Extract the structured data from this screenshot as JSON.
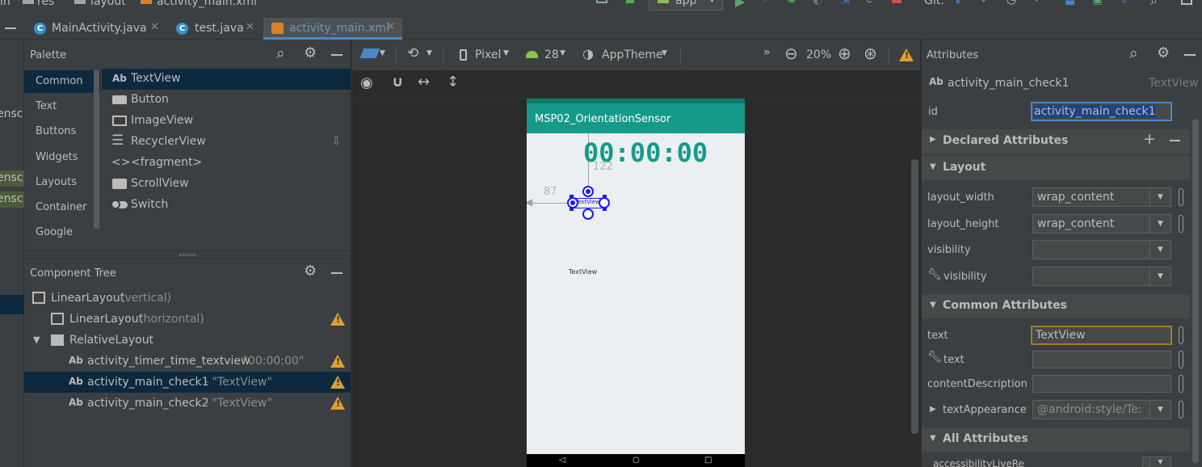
{
  "breadcrumb": {
    "seg1": "in",
    "seg2": "res",
    "seg3": "layout",
    "seg4": "activity_main.xml"
  },
  "toolbar": {
    "run_config": "app",
    "git_label": "Git:"
  },
  "tabs": [
    {
      "label": "MainActivity.java",
      "icon": "class-icon"
    },
    {
      "label": "test.java",
      "icon": "class-icon"
    },
    {
      "label": "activity_main.xml",
      "icon": "layout-xml-icon"
    }
  ],
  "left_edge_fragments": [
    "ensc",
    "ensc",
    "ensc"
  ],
  "palette": {
    "title": "Palette",
    "categories": [
      "Common",
      "Text",
      "Buttons",
      "Widgets",
      "Layouts",
      "Container",
      "Google"
    ],
    "items": [
      {
        "prefix": "Ab",
        "label": "TextView"
      },
      {
        "prefix": "",
        "label": "Button"
      },
      {
        "prefix": "",
        "label": "ImageView"
      },
      {
        "prefix": "",
        "label": "RecyclerView"
      },
      {
        "prefix": "<>",
        "label": "<fragment>"
      },
      {
        "prefix": "",
        "label": "ScrollView"
      },
      {
        "prefix": "",
        "label": "Switch"
      }
    ]
  },
  "component_tree": {
    "title": "Component Tree",
    "rows": [
      {
        "name": "LinearLayout",
        "suffix": "(vertical)",
        "warn": false
      },
      {
        "name": "LinearLayout",
        "suffix": "(horizontal)",
        "warn": true
      },
      {
        "name": "RelativeLayout",
        "suffix": "",
        "warn": false
      },
      {
        "name": "activity_timer_time_textview",
        "suffix": "- \"00:00:00\"",
        "warn": true
      },
      {
        "name": "activity_main_check1",
        "suffix": "- \"TextView\"",
        "warn": true
      },
      {
        "name": "activity_main_check2",
        "suffix": "- \"TextView\"",
        "warn": true
      }
    ]
  },
  "design_toolbar": {
    "device": "Pixel",
    "api": "28",
    "theme": "AppTheme",
    "zoom": "20%"
  },
  "device_preview": {
    "app_title": "MSP02_OrientationSensor",
    "timer": "00:00:00",
    "margin_top": "122",
    "margin_left": "87",
    "selected_text": "TextView",
    "textview2": "TextView"
  },
  "attributes": {
    "title": "Attributes",
    "component_name": "activity_main_check1",
    "component_type": "TextView",
    "id_label": "id",
    "id_value": "activity_main_check1",
    "sections": {
      "declared": "Declared Attributes",
      "layout": "Layout",
      "common": "Common Attributes",
      "all": "All Attributes"
    },
    "layout_width_label": "layout_width",
    "layout_width_value": "wrap_content",
    "layout_height_label": "layout_height",
    "layout_height_value": "wrap_content",
    "visibility_label": "visibility",
    "tools_visibility_label": "visibility",
    "text_label": "text",
    "text_value": "TextView",
    "tools_text_label": "text",
    "content_desc_label": "contentDescription",
    "text_appearance_label": "textAppearance",
    "text_appearance_value": "@android:style/Te:",
    "partial_row_label": "accessibilityLiveRe"
  },
  "colors": {
    "accent": "#4a88c7",
    "warning": "#e0a030",
    "app_bar": "#159a8a"
  }
}
